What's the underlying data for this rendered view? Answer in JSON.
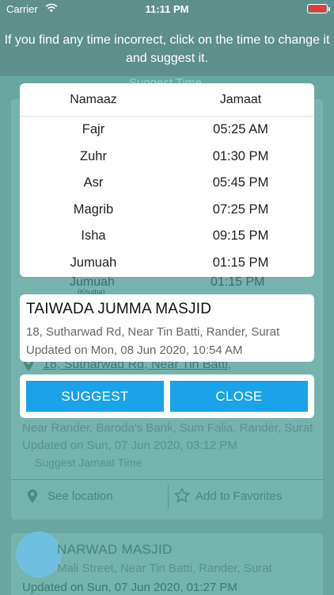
{
  "status_bar": {
    "carrier": "Carrier",
    "time": "11:11 PM"
  },
  "banner": {
    "text": "If you find any time incorrect, click on the time to change it and suggest it."
  },
  "background": {
    "suggest_time": "Suggest Time",
    "jumuah_label": "Jumuah",
    "jumuah_time": "01:15 PM",
    "khutba_label": "(Khutba)",
    "address_link": "18, Sutharwad Rd, Near Tin Batti,",
    "address_line2": "Near Rander, Baroda's Bank, Sum Falia, Rander, Surat",
    "updated_1": "Updated on Sun, 07 Jun 2020, 03:12 PM",
    "suggest_link": "Suggest Jamaat Time",
    "see_location": "See location",
    "add_favorites": "Add to Favorites",
    "card2_title": "NARWAD MASJID",
    "card2_address": "Mali Street, Near Tin Batti, Rander, Surat",
    "updated_2": "Updated on Sun, 07 Jun 2020, 01:27 PM"
  },
  "timings": {
    "header_name": "Namaaz",
    "header_time": "Jamaat",
    "rows": [
      {
        "name": "Fajr",
        "time": "05:25 AM"
      },
      {
        "name": "Zuhr",
        "time": "01:30 PM"
      },
      {
        "name": "Asr",
        "time": "05:45 PM"
      },
      {
        "name": "Magrib",
        "time": "07:25 PM"
      },
      {
        "name": "Isha",
        "time": "09:15 PM"
      },
      {
        "name": "Jumuah",
        "time": "01:15 PM"
      }
    ]
  },
  "masjid": {
    "name": "TAIWADA JUMMA MASJID",
    "address": "18, Sutharwad Rd, Near Tin Batti, Rander, Surat",
    "updated": "Updated on Mon, 08 Jun 2020, 10:54 AM"
  },
  "actions": {
    "suggest_label": "SUGGEST",
    "close_label": "CLOSE"
  },
  "colors": {
    "accent": "#1aa3e8",
    "overlay": "#5e8f8b",
    "battery": "#e53935"
  },
  "icons": [
    "wifi-icon",
    "battery-icon",
    "location-pin-icon",
    "star-icon"
  ]
}
